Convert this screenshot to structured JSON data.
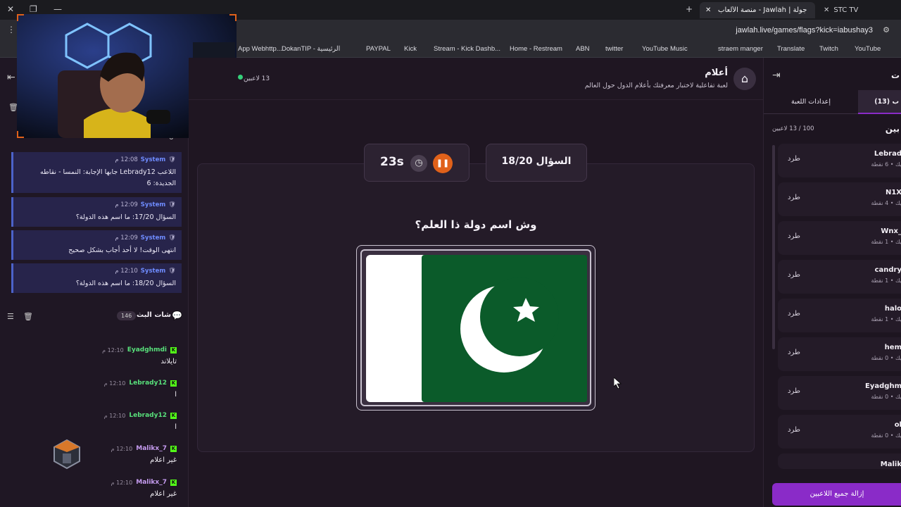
{
  "browser": {
    "tabs": [
      {
        "label": "جولة | Jawlah - منصة الألعاب الت...",
        "active": true
      },
      {
        "label": "STC TV",
        "active": false
      }
    ],
    "url": "jawlah.live/games/flags?kick=iabushay3",
    "bookmarks": [
      "App Webhttp...",
      "DokanTIP - الرئيسية",
      "PAYPAL",
      "Kick",
      "Stream - Kick Dashb...",
      "Home - Restream",
      "ABN",
      "twitter",
      "YouTube Music",
      "straem manger",
      "Translate",
      "Twitch",
      "YouTube"
    ]
  },
  "left": {
    "system_messages": [
      {
        "sender": "System",
        "time": "12:08 م",
        "text": "اللاعب Lebrady12 جابها الإجابة: النمسا - نقاطه الجديدة: 6"
      },
      {
        "sender": "System",
        "time": "12:09 م",
        "text": "السؤال 17/20: ما اسم هذه الدولة؟"
      },
      {
        "sender": "System",
        "time": "12:09 م",
        "text": "انتهى الوقت! لا أحد أجاب بشكل صحيح"
      },
      {
        "sender": "System",
        "time": "12:10 م",
        "text": "السؤال 18/20: ما اسم هذه الدولة؟"
      }
    ],
    "partial_number": "6",
    "stream_chat_title": "شات البث",
    "stream_chat_count": "146",
    "chat_messages": [
      {
        "user": "Eyadghmdi",
        "color": "#58e07b",
        "time": "12:10 م",
        "text": "تايلاند"
      },
      {
        "user": "Lebrady12",
        "color": "#58e07b",
        "time": "12:10 م",
        "text": "ا"
      },
      {
        "user": "Lebrady12",
        "color": "#58e07b",
        "time": "12:10 م",
        "text": "ا"
      },
      {
        "user": "Malikx_7",
        "color": "#c69cf0",
        "time": "12:10 م",
        "text": "غير اعلام"
      },
      {
        "user": "Malikx_7",
        "color": "#c69cf0",
        "time": "12:10 م",
        "text": "غير اعلام"
      }
    ]
  },
  "game": {
    "title": "أعلام",
    "subtitle": "لعبة تفاعلية لاختبار معرفتك بأعلام الدول حول العالم",
    "players_online": "13 لاعبين",
    "question_counter": "السؤال 18/20",
    "timer": "23s",
    "question": "وش اسم دولة ذا العلم؟",
    "flag_colors": {
      "green": "#0b5b2a",
      "white": "#ffffff"
    }
  },
  "right": {
    "title_partial": "ت",
    "tabs": [
      "(13) ب",
      "إعدادات اللعبة"
    ],
    "players_header": "بين",
    "players_count": "100 / 13 لاعبين",
    "kick_label": "طرد",
    "players": [
      {
        "name": "Lebrad",
        "score": "يك • 6 نقطة"
      },
      {
        "name": "N1X",
        "score": "يك • 4 نقطة"
      },
      {
        "name": "Wnx_",
        "score": "يك • 1 نقطة"
      },
      {
        "name": "candry",
        "score": "يك • 1 نقطة"
      },
      {
        "name": "halo",
        "score": "يك • 1 نقطة"
      },
      {
        "name": "hem",
        "score": "يك • 0 نقطة"
      },
      {
        "name": "Eyadghm",
        "score": "يك • 0 نقطة"
      },
      {
        "name": "ol",
        "score": "يك • 0 نقطة"
      },
      {
        "name": "Malik",
        "score": ""
      }
    ],
    "remove_all": "إزالة جميع اللاعبين"
  },
  "colors": {
    "accent_orange": "#e0611a",
    "accent_purple": "#8a2bc8",
    "online_green": "#35d07a"
  }
}
